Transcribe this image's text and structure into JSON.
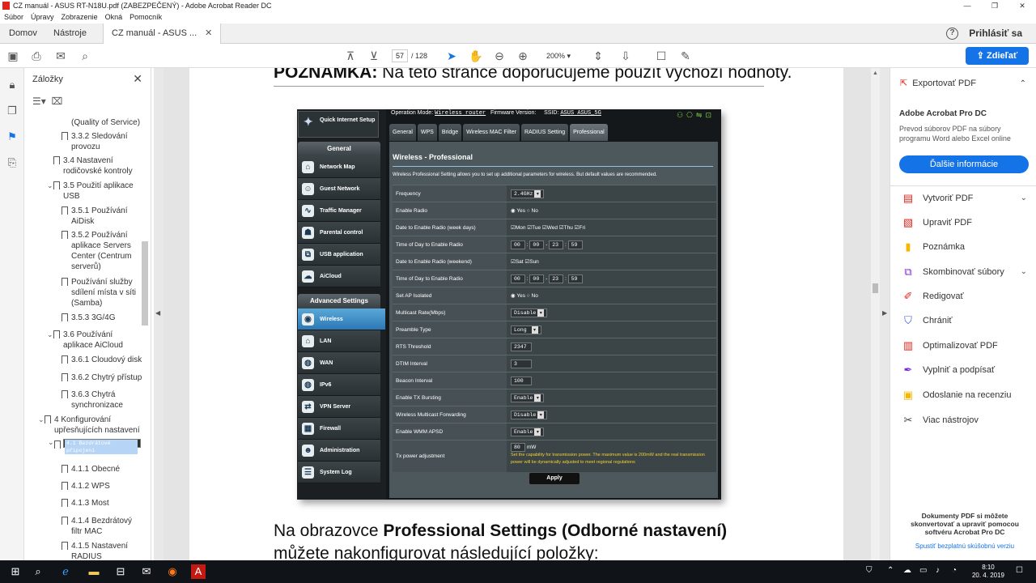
{
  "window": {
    "title": "CZ manuál - ASUS RT-N18U.pdf (ZABEZPEČENÝ) - Adobe Acrobat Reader DC"
  },
  "menu": [
    "Súbor",
    "Úpravy",
    "Zobrazenie",
    "Okná",
    "Pomocník"
  ],
  "tabs": {
    "home": "Domov",
    "tools": "Nástroje",
    "doc": "CZ manuál - ASUS ...",
    "signin": "Prihlásiť sa"
  },
  "toolbar": {
    "page_current": "57",
    "page_total": "/ 128",
    "zoom": "200%",
    "share_label": "Zdieľať"
  },
  "bookmarks": {
    "title": "Záložky",
    "items": [
      {
        "label": "(Quality of Service)"
      },
      {
        "label": "3.3.2 Sledování provozu"
      },
      {
        "label": "3.4 Nastavení rodičovské kontroly"
      },
      {
        "label": "3.5 Použití aplikace USB"
      },
      {
        "label": "3.5.1 Používání AiDisk"
      },
      {
        "label": "3.5.2 Používání aplikace Servers Center (Centrum serverů)"
      },
      {
        "label": "Používání služby sdílení místa v síti (Samba)"
      },
      {
        "label": "3.5.3 3G/4G"
      },
      {
        "label": "3.6 Používání aplikace AiCloud"
      },
      {
        "label": "3.6.1 Cloudový disk"
      },
      {
        "label": "3.6.2 Chytrý přístup"
      },
      {
        "label": "3.6.3 Chytrá synchronizace"
      },
      {
        "label": "4 Konfigurování upřesňujících nastavení"
      },
      {
        "label": "4.1 Bezdrátové připojení"
      },
      {
        "label": "4.1.1 Obecné"
      },
      {
        "label": "4.1.2 WPS"
      },
      {
        "label": "4.1.3 Most"
      },
      {
        "label": "4.1.4 Bezdrátový filtr MAC"
      },
      {
        "label": "4.1.5 Nastavení RADIUS"
      }
    ]
  },
  "document": {
    "heading_bold": "POZNÁMKA:",
    "heading_rest": " Na této stránce doporučujeme použít výchozí hodnoty.",
    "caption_pre": "Na obrazovce ",
    "caption_bold": "Professional Settings (Odborné nastavení)",
    "caption_line2": "můžete nakonfigurovat následující položky:"
  },
  "router": {
    "qis": "Quick Internet Setup",
    "general_header": "General",
    "nav": [
      "Network Map",
      "Guest Network",
      "Traffic Manager",
      "Parental control",
      "USB application",
      "AiCloud"
    ],
    "adv_header": "Advanced Settings",
    "adv_nav": [
      "Wireless",
      "LAN",
      "WAN",
      "IPv6",
      "VPN Server",
      "Firewall",
      "Administration",
      "System Log"
    ],
    "opmode_label": "Operation Mode:",
    "opmode_value": "Wireless router",
    "firmware_label": "Firmware Version:",
    "ssid_label": "SSID:",
    "ssid_value": "ASUS ASUS_5G",
    "tabs": [
      "General",
      "WPS",
      "Bridge",
      "Wireless MAC Filter",
      "RADIUS Setting",
      "Professional"
    ],
    "title": "Wireless - Professional",
    "desc": "Wireless Professional Setting allows you to set up additional parameters for wireless. But default values are recommended.",
    "fields": {
      "frequency": {
        "label": "Frequency",
        "value": "2.4GHz"
      },
      "enable_radio": {
        "label": "Enable Radio",
        "yes": "Yes",
        "no": "No"
      },
      "date_week": {
        "label": "Date to Enable Radio (week days)",
        "days": [
          "Mon",
          "Tue",
          "Wed",
          "Thu",
          "Fri"
        ]
      },
      "time_week": {
        "label": "Time of Day to Enable Radio",
        "v1": "00",
        "v2": "00",
        "v3": "23",
        "v4": "59"
      },
      "date_weekend": {
        "label": "Date to Enable Radio (weekend)",
        "days": [
          "Sat",
          "Sun"
        ]
      },
      "time_weekend": {
        "label": "Time of Day to Enable Radio",
        "v1": "00",
        "v2": "00",
        "v3": "23",
        "v4": "59"
      },
      "ap_isolated": {
        "label": "Set AP Isolated",
        "yes": "Yes",
        "no": "No"
      },
      "multicast_rate": {
        "label": "Multicast Rate(Mbps)",
        "value": "Disable"
      },
      "preamble": {
        "label": "Preamble Type",
        "value": "Long"
      },
      "rts": {
        "label": "RTS Threshold",
        "value": "2347"
      },
      "dtim": {
        "label": "DTIM Interval",
        "value": "3"
      },
      "beacon": {
        "label": "Beacon Interval",
        "value": "100"
      },
      "tx_burst": {
        "label": "Enable TX Bursting",
        "value": "Enable"
      },
      "multicast_fwd": {
        "label": "Wireless Multicast Forwarding",
        "value": "Disable"
      },
      "wmm_apsd": {
        "label": "Enable WMM APSD",
        "value": "Enable"
      },
      "tx_power": {
        "label": "Tx power adjustment",
        "value": "80",
        "unit": "mW",
        "note": "Set the capability for transmission power. The maximum value is 200mW and the real transmission power will be dynamically adjusted to meet regional regulations"
      }
    },
    "apply": "Apply"
  },
  "right_panel": {
    "export": "Exportovať PDF",
    "product": "Adobe Acrobat Pro DC",
    "product_desc": "Prevod súborov PDF na súbory programu Word alebo Excel online",
    "more_info": "Ďalšie informácie",
    "tools": [
      {
        "label": "Vytvoriť PDF",
        "icon": "create-pdf-icon",
        "color": "#e2231a"
      },
      {
        "label": "Upraviť PDF",
        "icon": "edit-pdf-icon",
        "color": "#e2231a"
      },
      {
        "label": "Poznámka",
        "icon": "comment-icon",
        "color": "#f5b800"
      },
      {
        "label": "Skombinovať súbory",
        "icon": "combine-icon",
        "color": "#7b2bd6"
      },
      {
        "label": "Redigovať",
        "icon": "redact-icon",
        "color": "#e2231a"
      },
      {
        "label": "Chrániť",
        "icon": "protect-icon",
        "color": "#3b5bdb"
      },
      {
        "label": "Optimalizovať PDF",
        "icon": "optimize-icon",
        "color": "#e2231a"
      },
      {
        "label": "Vyplniť a podpísať",
        "icon": "fill-sign-icon",
        "color": "#7b2bd6"
      },
      {
        "label": "Odoslanie na recenziu",
        "icon": "review-icon",
        "color": "#f5b800"
      },
      {
        "label": "Viac nástrojov",
        "icon": "more-tools-icon",
        "color": "#444444"
      }
    ],
    "footer": "Dokumenty PDF si môžete skonvertovať a upraviť pomocou softvéru Acrobat Pro DC",
    "trial": "Spustiť bezplatnú skúšobnú verziu"
  },
  "taskbar": {
    "time": "8:10",
    "date": "20. 4. 2019"
  },
  "colors": {
    "accent": "#1473e6",
    "acrobat_red": "#e2231a",
    "selection": "#b6d4f5"
  }
}
